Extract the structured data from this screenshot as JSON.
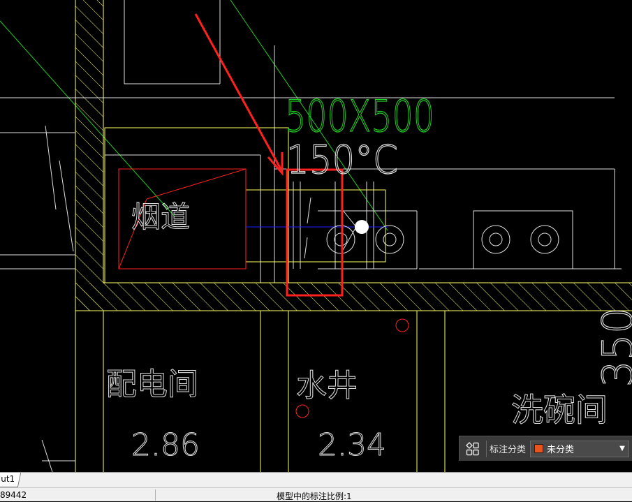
{
  "drawing": {
    "dimension_text": "500X500",
    "temperature_text": "150°C",
    "flue_label": "烟道",
    "room_power": "配电间",
    "room_power_value": "2.86",
    "room_well": "水井",
    "room_well_value": "2.34",
    "room_dish": "洗碗间",
    "partial_number": "350",
    "line_colors": {
      "wall": "#ffff66",
      "line": "#e0e0e0",
      "guide": "#22cc22",
      "highlight": "#ff2020",
      "center": "#2020ff"
    }
  },
  "annotation_panel": {
    "icon": "grid-icon",
    "label": "标注分类",
    "selected": "未分类",
    "swatch_color": "#e8541c"
  },
  "layout_tab": {
    "label": "ut1"
  },
  "status_bar": {
    "coordinates": "89442",
    "annotation_scale": "模型中的标注比例:1"
  }
}
